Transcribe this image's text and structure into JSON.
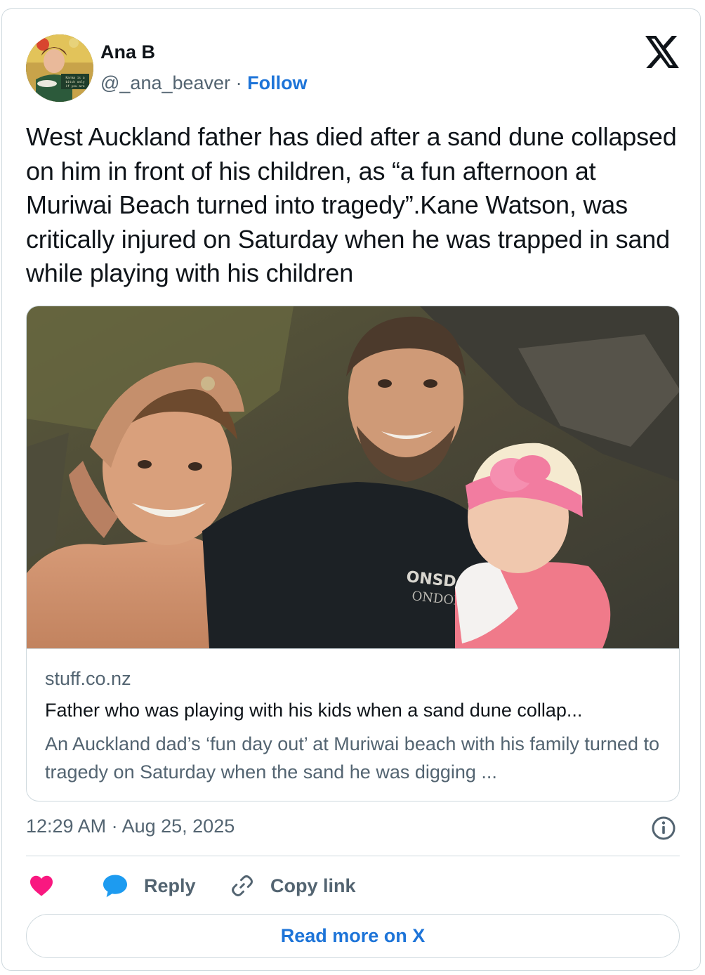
{
  "author": {
    "name": "Ana B",
    "handle": "@_ana_beaver",
    "separator": "·",
    "follow_label": "Follow",
    "avatar_caption": "Karma is a bitch only if you are"
  },
  "tweet": {
    "text": "West Auckland father has died after a sand dune collapsed on him in front of his children, as “a fun afternoon at Muriwai Beach turned into tragedy”.Kane Watson, was critically injured on Saturday when he was trapped in sand while playing with his children"
  },
  "link_card": {
    "photo_shirt_text": "LONSDALE LONDON",
    "domain": "stuff.co.nz",
    "title": "Father who was playing with his kids when a sand dune collap...",
    "description": "An Auckland dad’s ‘fun day out’ at Muriwai beach with his family turned to tragedy on Saturday when the sand he was digging ..."
  },
  "meta": {
    "timestamp": "12:29 AM · Aug 25, 2025"
  },
  "actions": {
    "reply_label": "Reply",
    "copy_link_label": "Copy link",
    "read_more_label": "Read more on X"
  },
  "colors": {
    "link_blue": "#1d74d8",
    "secondary_text": "#536471",
    "border": "#cfd9de",
    "like_heart": "#f91880",
    "reply_bubble": "#1d9bf0"
  },
  "icons": [
    "x-logo-icon",
    "info-icon",
    "heart-icon",
    "reply-bubble-icon",
    "link-icon"
  ]
}
